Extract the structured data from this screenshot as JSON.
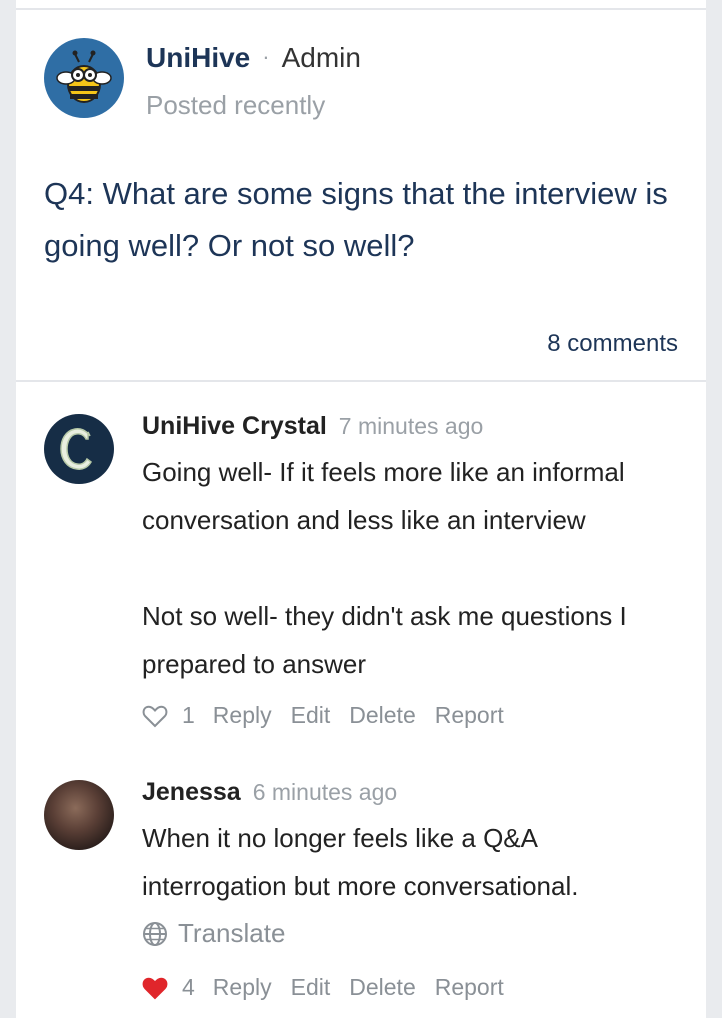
{
  "post": {
    "author": "UniHive",
    "separator": "·",
    "role": "Admin",
    "posted": "Posted recently",
    "question": "Q4: What are some signs that the interview is going well? Or not so well?",
    "comment_count": "8 comments"
  },
  "comments": [
    {
      "author": "UniHive Crystal",
      "time": "7 minutes ago",
      "body_p1": "Going well- If it feels more like an informal conversation and less like an interview",
      "body_p2": "Not so well- they didn't ask me questions I prepared to answer",
      "likes": "1",
      "liked": false,
      "reply": "Reply",
      "edit": "Edit",
      "delete": "Delete",
      "report": "Report"
    },
    {
      "author": "Jenessa",
      "time": "6 minutes ago",
      "body_p1": "When it no longer feels like a Q&A interrogation but more conversational.",
      "translate": "Translate",
      "likes": "4",
      "liked": true,
      "reply": "Reply",
      "edit": "Edit",
      "delete": "Delete",
      "report": "Report"
    }
  ],
  "colors": {
    "accent": "#1d3557",
    "muted": "#9aa0a6",
    "heart_liked": "#e0262b",
    "avatar_bee": "#2f6ea5",
    "avatar_c": "#162d46"
  }
}
